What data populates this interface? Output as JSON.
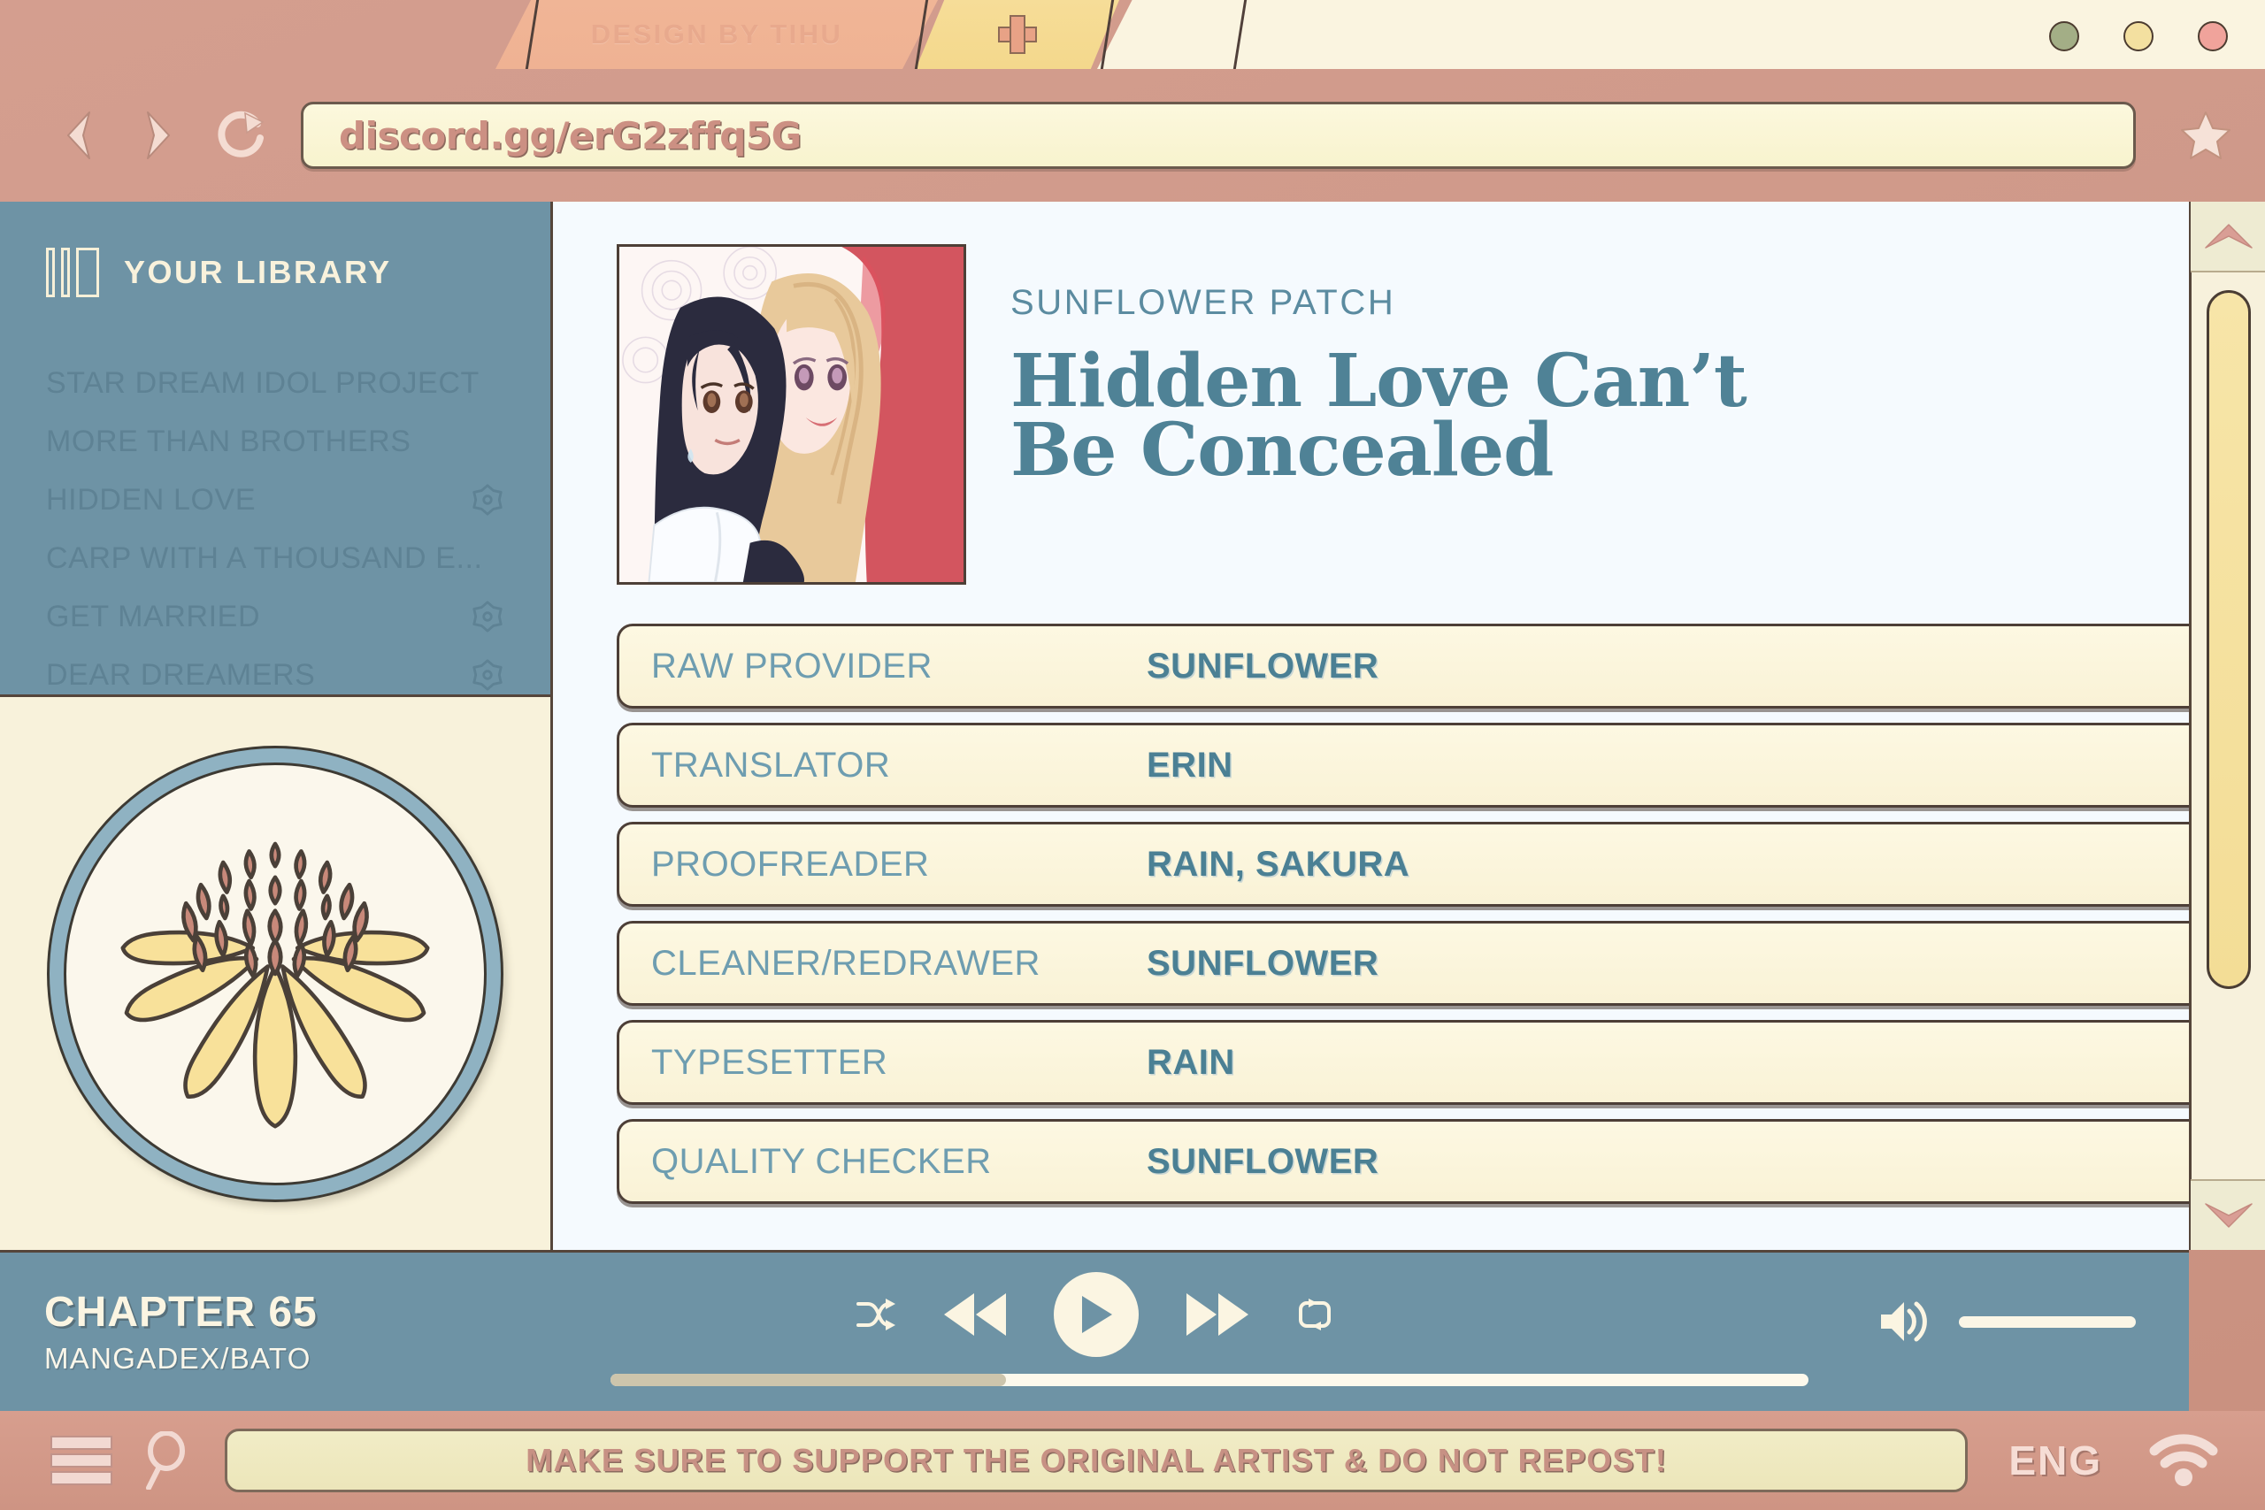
{
  "window": {
    "tab_label": "DESIGN BY TIHU",
    "new_tab_icon": "plus-icon",
    "dots": [
      {
        "name": "minimize-dot",
        "color": "#a3ae86"
      },
      {
        "name": "maximize-dot",
        "color": "#f3e0a0"
      },
      {
        "name": "close-dot",
        "color": "#f0a39b"
      }
    ]
  },
  "nav": {
    "back_icon": "chevron-left-icon",
    "forward_icon": "chevron-right-icon",
    "reload_icon": "reload-icon",
    "url": "discord.gg/erG2zffq5G",
    "bookmark_icon": "star-icon"
  },
  "sidebar": {
    "header": "YOUR LIBRARY",
    "header_icon": "library-icon",
    "items": [
      {
        "label": "STAR DREAM IDOL PROJECT",
        "badge": false
      },
      {
        "label": "MORE THAN BROTHERS",
        "badge": false
      },
      {
        "label": "HIDDEN LOVE",
        "badge": true
      },
      {
        "label": "CARP WITH A THOUSAND E...",
        "badge": false
      },
      {
        "label": "GET MARRIED",
        "badge": true
      },
      {
        "label": "DEAR DREAMERS",
        "badge": true
      }
    ],
    "logo_name": "sunflower-logo"
  },
  "main": {
    "cover_alt": "hidden-love-cover-art",
    "kicker": "SUNFLOWER PATCH",
    "title_line1": "Hidden Love Can’t",
    "title_line2": "Be Concealed",
    "credits": [
      {
        "label": "RAW PROVIDER",
        "value": "SUNFLOWER"
      },
      {
        "label": "TRANSLATOR",
        "value": "ERIN"
      },
      {
        "label": "PROOFREADER",
        "value": "RAIN, SAKURA"
      },
      {
        "label": "CLEANER/REDRAWER",
        "value": "SUNFLOWER"
      },
      {
        "label": "TYPESETTER",
        "value": "RAIN"
      },
      {
        "label": "QUALITY CHECKER",
        "value": "SUNFLOWER"
      }
    ]
  },
  "scrollbar": {
    "up_icon": "chevron-up-icon",
    "down_icon": "chevron-down-icon",
    "thumb_name": "scrollbar-thumb"
  },
  "player": {
    "title": "CHAPTER 65",
    "subtitle": "MANGADEX/BATO",
    "shuffle_icon": "shuffle-icon",
    "previous_icon": "rewind-icon",
    "play_icon": "play-icon",
    "next_icon": "fast-forward-icon",
    "repeat_icon": "repeat-icon",
    "progress_percent": 33,
    "volume_icon": "volume-high-icon",
    "volume_percent": 100
  },
  "bottom": {
    "menu_icon": "hamburger-menu-icon",
    "search_icon": "search-icon",
    "banner": "MAKE SURE TO SUPPORT THE ORIGINAL ARTIST & DO NOT REPOST!",
    "language": "ENG",
    "wifi_icon": "wifi-icon"
  },
  "colors": {
    "frame": "#ce9483",
    "teal": "#6e93a5",
    "cream": "#faf4e0",
    "title_teal": "#4f8296",
    "yellow": "#f3dd96"
  }
}
